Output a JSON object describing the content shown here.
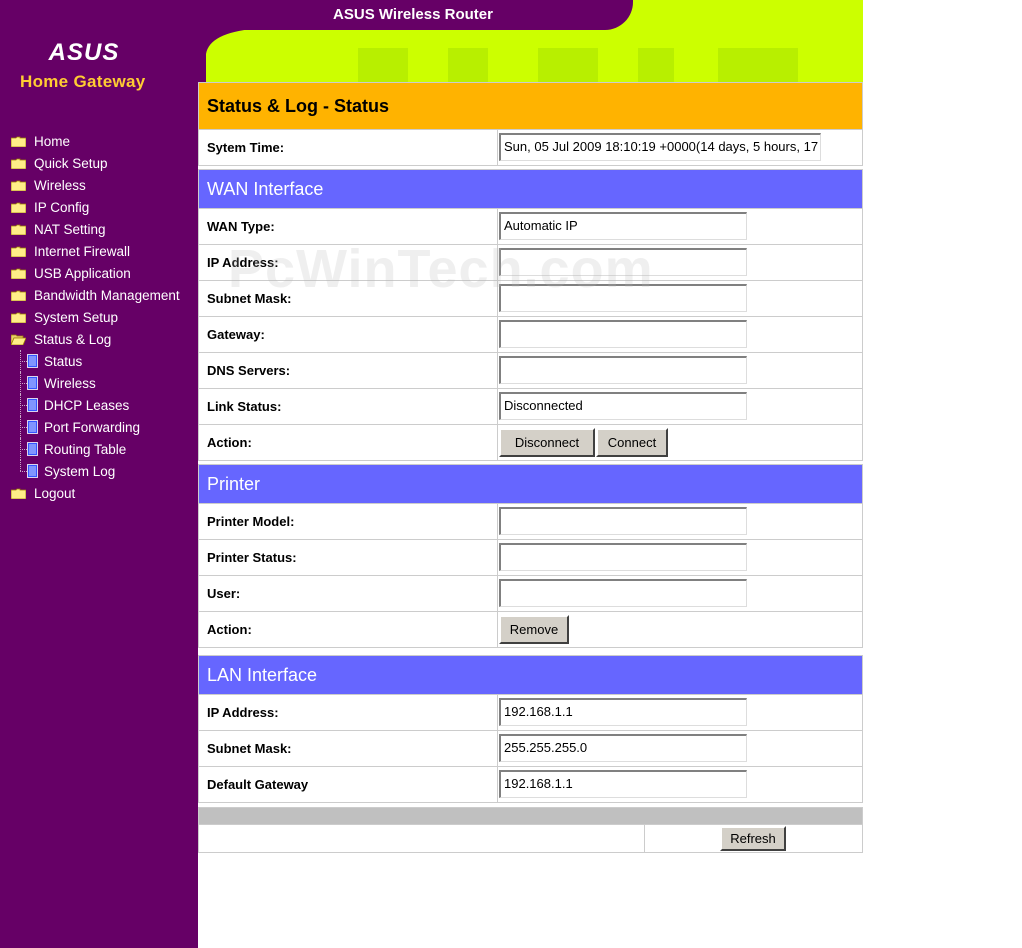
{
  "brand": {
    "logo_text": "ASUS",
    "subtitle": "Home Gateway",
    "banner_title": "ASUS Wireless Router"
  },
  "nav": {
    "items": [
      {
        "label": "Home",
        "icon": "folder-icon"
      },
      {
        "label": "Quick Setup",
        "icon": "folder-icon"
      },
      {
        "label": "Wireless",
        "icon": "folder-icon"
      },
      {
        "label": "IP Config",
        "icon": "folder-icon"
      },
      {
        "label": "NAT Setting",
        "icon": "folder-icon"
      },
      {
        "label": "Internet Firewall",
        "icon": "folder-icon"
      },
      {
        "label": "USB Application",
        "icon": "folder-icon"
      },
      {
        "label": "Bandwidth Management",
        "icon": "folder-icon"
      },
      {
        "label": "System Setup",
        "icon": "folder-icon"
      },
      {
        "label": "Status & Log",
        "icon": "open-folder-icon"
      }
    ],
    "subitems": [
      {
        "label": "Status",
        "icon": "document-icon"
      },
      {
        "label": "Wireless",
        "icon": "document-icon"
      },
      {
        "label": "DHCP Leases",
        "icon": "document-icon"
      },
      {
        "label": "Port Forwarding",
        "icon": "document-icon"
      },
      {
        "label": "Routing Table",
        "icon": "document-icon"
      },
      {
        "label": "System Log",
        "icon": "document-icon"
      }
    ],
    "logout": {
      "label": "Logout",
      "icon": "folder-icon"
    }
  },
  "page": {
    "title": "Status & Log - Status",
    "system_time_label": "Sytem Time:",
    "system_time_value": "Sun, 05 Jul 2009 18:10:19 +0000(14 days, 5 hours, 17"
  },
  "wan": {
    "header": "WAN Interface",
    "type_label": "WAN Type:",
    "type_value": "Automatic IP",
    "ip_label": "IP Address:",
    "ip_value": "",
    "mask_label": "Subnet Mask:",
    "mask_value": "",
    "gateway_label": "Gateway:",
    "gateway_value": "",
    "dns_label": "DNS Servers:",
    "dns_value": "",
    "link_label": "Link Status:",
    "link_value": "Disconnected",
    "action_label": "Action:",
    "disconnect_button": "Disconnect",
    "connect_button": "Connect"
  },
  "printer": {
    "header": "Printer",
    "model_label": "Printer Model:",
    "model_value": "",
    "status_label": "Printer Status:",
    "status_value": "",
    "user_label": "User:",
    "user_value": "",
    "action_label": "Action:",
    "remove_button": "Remove"
  },
  "lan": {
    "header": "LAN Interface",
    "ip_label": "IP Address:",
    "ip_value": "192.168.1.1",
    "mask_label": "Subnet Mask:",
    "mask_value": "255.255.255.0",
    "gateway_label": "Default Gateway",
    "gateway_value": "192.168.1.1"
  },
  "footer": {
    "refresh_button": "Refresh"
  },
  "watermark": "PcWinTech.com",
  "colors": {
    "sidebar": "#660066",
    "banner": "#ccff00",
    "title_bar": "#ffb300",
    "section_header": "#6666ff",
    "subtitle": "#ffcc33"
  }
}
